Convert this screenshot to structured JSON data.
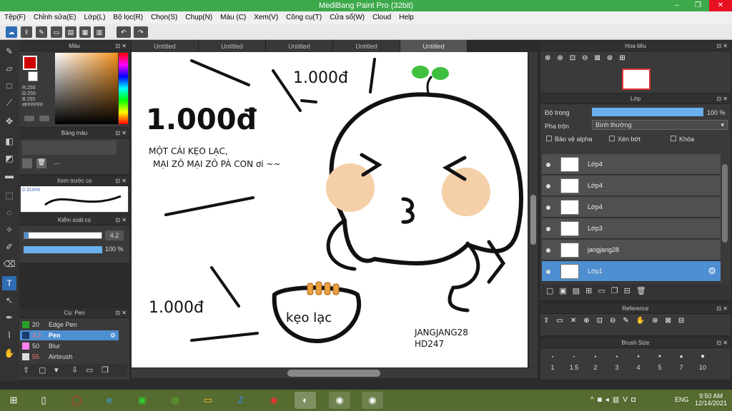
{
  "window": {
    "title": "MediBang Paint Pro (32bit)",
    "minimize": "–",
    "restore": "❐",
    "close": "✕"
  },
  "menu": [
    "Tệp(F)",
    "Chỉnh sửa(E)",
    "Lớp(L)",
    "Bộ lọc(R)",
    "Chọn(S)",
    "Chụp(N)",
    "Màu (C)",
    "Xem(V)",
    "Công cụ(T)",
    "Cửa sổ(W)",
    "Cloud",
    "Help"
  ],
  "toolbar_icons": [
    "cloud-icon",
    "export-icon",
    "comment-icon",
    "message-icon",
    "page-icon",
    "grid-icon",
    "panels-icon",
    "undo-icon",
    "redo-icon"
  ],
  "tabs": [
    "Untitled",
    "Untitled",
    "Untitled",
    "Untitled",
    "Untitled"
  ],
  "color_panel": {
    "title": "Màu",
    "r": "R:255",
    "g": "G:255",
    "b": "B:255",
    "hex": "#FFFFFF"
  },
  "palette_panel": {
    "title": "Bảng màu",
    "dash": "---"
  },
  "brush_preview": {
    "title": "Xem trước cọ",
    "size": "0.31mm"
  },
  "brush_control": {
    "title": "Kiểm soát cọ",
    "size_value": "4.2",
    "opacity_value": "100 %"
  },
  "brush_list": {
    "title": "Cọ: Pen",
    "items": [
      {
        "size": "20",
        "name": "Edge Pen",
        "color": "#2aa02a"
      },
      {
        "size": "4.2",
        "name": "Pen",
        "color": "#1a3a6a"
      },
      {
        "size": "50",
        "name": "Blur",
        "color": "#ff7ff0"
      },
      {
        "size": "55",
        "name": "Airbrush",
        "color": "#dddddd"
      }
    ]
  },
  "navigator": {
    "title": "Hoa tiêu"
  },
  "layer_panel": {
    "title": "Lớp",
    "opacity_label": "Độ trong",
    "opacity_value": "100 %",
    "blend_label": "Pha trộn",
    "blend_value": "Bình thường",
    "protect_alpha": "Bảo vệ alpha",
    "clipping": "Xén bớt",
    "lock": "Khóa",
    "layers": [
      "Lớp4",
      "Lớp4",
      "Lớp4",
      "Lớp3",
      "jangjang28",
      "Lớp1"
    ]
  },
  "reference_panel": {
    "title": "Reference"
  },
  "brush_size_panel": {
    "title": "Brush Size",
    "sizes": [
      "1",
      "1.5",
      "2",
      "3",
      "4",
      "5",
      "7",
      "10"
    ]
  },
  "canvas_text": {
    "price1": "1.000đ",
    "price2": "1.000đ",
    "price3": "1.000đ",
    "line1": "MỘT CÁI KẸO LẠC,",
    "line2": "MẠI ZÔ MẠI ZÔ PÀ CON ơi ~~",
    "bag": "kẹo lạc",
    "sig1": "JANGJANG28",
    "sig2": "HD247"
  },
  "taskbar": {
    "time": "9:50 AM",
    "date": "12/14/2021",
    "lang": "ENG"
  },
  "colors": {
    "accent": "#4d8fd0",
    "titlebar": "#3ca94a",
    "cheek": "#f5cfa8",
    "sprout": "#3fbf3f"
  }
}
